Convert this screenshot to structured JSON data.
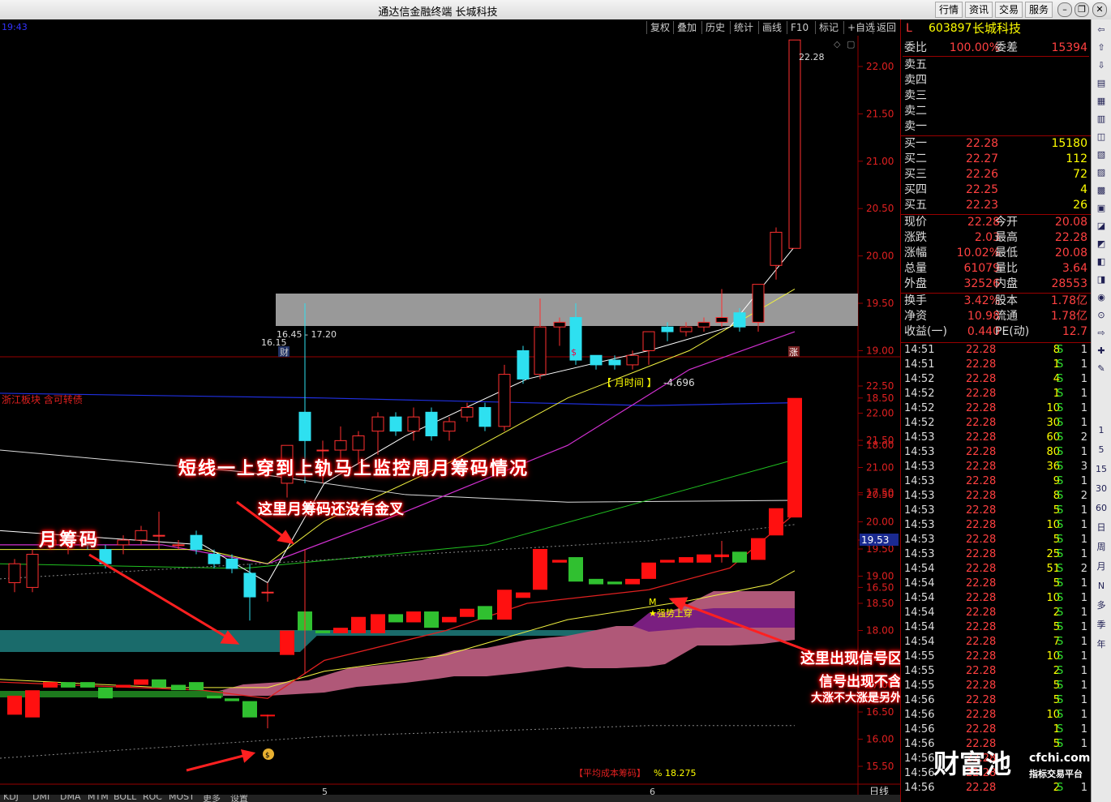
{
  "window": {
    "title": "通达信金融终端  长城科技",
    "menu": [
      "行情",
      "资讯",
      "交易",
      "服务"
    ]
  },
  "toolbar": {
    "time_left": "19:43",
    "buttons": [
      "复权",
      "叠加",
      "历史",
      "统计",
      "画线",
      "F10",
      "标记",
      "+自选",
      "返回"
    ]
  },
  "upper_chart": {
    "price_axis": [
      "22.00",
      "21.50",
      "21.00",
      "20.50",
      "20.00",
      "19.50",
      "19.00",
      "18.50",
      "18.00",
      "17.50",
      "17.00",
      "16.50"
    ],
    "high_label": "22.28",
    "range_label": "16.45 - 17.20",
    "low_label": "16.15",
    "markers": [
      "财",
      "$",
      "涨"
    ]
  },
  "lower_chart": {
    "sector_label": "浙江板块 含可转债",
    "indicator_label": "【 月时间 】",
    "indicator_value": "-4.696",
    "price_axis": [
      "22.50",
      "22.00",
      "21.50",
      "21.00",
      "20.50",
      "20.00",
      "19.50",
      "19.00",
      "18.50",
      "18.00",
      "17.50",
      "17.00",
      "16.50",
      "16.00",
      "15.50"
    ],
    "current_price_tag": "19.53",
    "signal_m": "M",
    "signal_text": "★强势上穿",
    "avg_cost_label": "【平均成本筹码】",
    "avg_cost_value": "% 18.275",
    "date_marks": [
      "5",
      "6"
    ],
    "period": "日线"
  },
  "annotations": {
    "main": "短线一上穿到上轨马上监控周月筹码情况",
    "sub": "这里月筹码还没有金叉",
    "left": "月筹码",
    "right1": "这里出现信号区域了",
    "right2": "信号出现不含飘",
    "right3": "大涨不大涨是另外的事"
  },
  "bottom_tabs": [
    "KDJ",
    "DMI",
    "DMA",
    "MTM",
    "BOLL",
    "ROC",
    "MOST",
    "更多",
    "设置"
  ],
  "quote": {
    "code": "603897",
    "name": "长城科技",
    "header": {
      "l1": "委比",
      "v1": "100.00%",
      "l2": "委差",
      "v2": "15394"
    },
    "sell": [
      {
        "l": "卖五"
      },
      {
        "l": "卖四"
      },
      {
        "l": "卖三"
      },
      {
        "l": "卖二"
      },
      {
        "l": "卖一"
      }
    ],
    "buy": [
      {
        "l": "买一",
        "p": "22.28",
        "v": "15180"
      },
      {
        "l": "买二",
        "p": "22.27",
        "v": "112"
      },
      {
        "l": "买三",
        "p": "22.26",
        "v": "72"
      },
      {
        "l": "买四",
        "p": "22.25",
        "v": "4"
      },
      {
        "l": "买五",
        "p": "22.23",
        "v": "26"
      }
    ],
    "stats1": [
      {
        "l1": "现价",
        "v1": "22.28",
        "l2": "今开",
        "v2": "20.08"
      },
      {
        "l1": "涨跌",
        "v1": "2.03",
        "l2": "最高",
        "v2": "22.28"
      },
      {
        "l1": "涨幅",
        "v1": "10.02%",
        "l2": "最低",
        "v2": "20.08"
      },
      {
        "l1": "总量",
        "v1": "61079",
        "l2": "量比",
        "v2": "3.64"
      },
      {
        "l1": "外盘",
        "v1": "32526",
        "l2": "内盘",
        "v2": "28553"
      }
    ],
    "stats2": [
      {
        "l1": "换手",
        "v1": "3.42%",
        "l2": "股本",
        "v2": "1.78亿"
      },
      {
        "l1": "净资",
        "v1": "10.98",
        "l2": "流通",
        "v2": "1.78亿"
      },
      {
        "l1": "收益(一)",
        "v1": "0.440",
        "l2": "PE(动)",
        "v2": "12.7"
      }
    ],
    "ticks": [
      [
        "14:51",
        "22.28",
        "8",
        "S",
        "1"
      ],
      [
        "14:51",
        "22.28",
        "1",
        "S",
        "1"
      ],
      [
        "14:52",
        "22.28",
        "4",
        "S",
        "1"
      ],
      [
        "14:52",
        "22.28",
        "1",
        "S",
        "1"
      ],
      [
        "14:52",
        "22.28",
        "10",
        "S",
        "1"
      ],
      [
        "14:52",
        "22.28",
        "30",
        "S",
        "1"
      ],
      [
        "14:53",
        "22.28",
        "60",
        "S",
        "2"
      ],
      [
        "14:53",
        "22.28",
        "80",
        "S",
        "1"
      ],
      [
        "14:53",
        "22.28",
        "36",
        "S",
        "3"
      ],
      [
        "14:53",
        "22.28",
        "9",
        "S",
        "1"
      ],
      [
        "14:53",
        "22.28",
        "8",
        "S",
        "2"
      ],
      [
        "14:53",
        "22.28",
        "5",
        "S",
        "1"
      ],
      [
        "14:53",
        "22.28",
        "10",
        "S",
        "1"
      ],
      [
        "14:53",
        "22.28",
        "5",
        "S",
        "1"
      ],
      [
        "14:53",
        "22.28",
        "25",
        "S",
        "1"
      ],
      [
        "14:54",
        "22.28",
        "51",
        "S",
        "2"
      ],
      [
        "14:54",
        "22.28",
        "5",
        "S",
        "1"
      ],
      [
        "14:54",
        "22.28",
        "10",
        "S",
        "1"
      ],
      [
        "14:54",
        "22.28",
        "2",
        "S",
        "1"
      ],
      [
        "14:54",
        "22.28",
        "5",
        "S",
        "1"
      ],
      [
        "14:54",
        "22.28",
        "7",
        "S",
        "1"
      ],
      [
        "14:55",
        "22.28",
        "10",
        "S",
        "1"
      ],
      [
        "14:55",
        "22.28",
        "2",
        "S",
        "1"
      ],
      [
        "14:55",
        "22.28",
        "5",
        "S",
        "1"
      ],
      [
        "14:56",
        "22.28",
        "5",
        "S",
        "1"
      ],
      [
        "14:56",
        "22.28",
        "10",
        "S",
        "1"
      ],
      [
        "14:56",
        "22.28",
        "1",
        "S",
        "1"
      ],
      [
        "14:56",
        "22.28",
        "5",
        "S",
        "1"
      ],
      [
        "14:56",
        "22.28",
        "",
        "",
        ""
      ],
      [
        "14:56",
        "22.28",
        "",
        "",
        ""
      ],
      [
        "14:56",
        "22.28",
        "2",
        "S",
        "1"
      ]
    ]
  },
  "watermark": {
    "brand": "财富池",
    "site": "cfchi.com",
    "tagline": "指标交易平台"
  },
  "side_icons": [
    "1",
    "5",
    "15",
    "30",
    "60",
    "日",
    "周",
    "月",
    "N",
    "多",
    "季",
    "年"
  ]
}
